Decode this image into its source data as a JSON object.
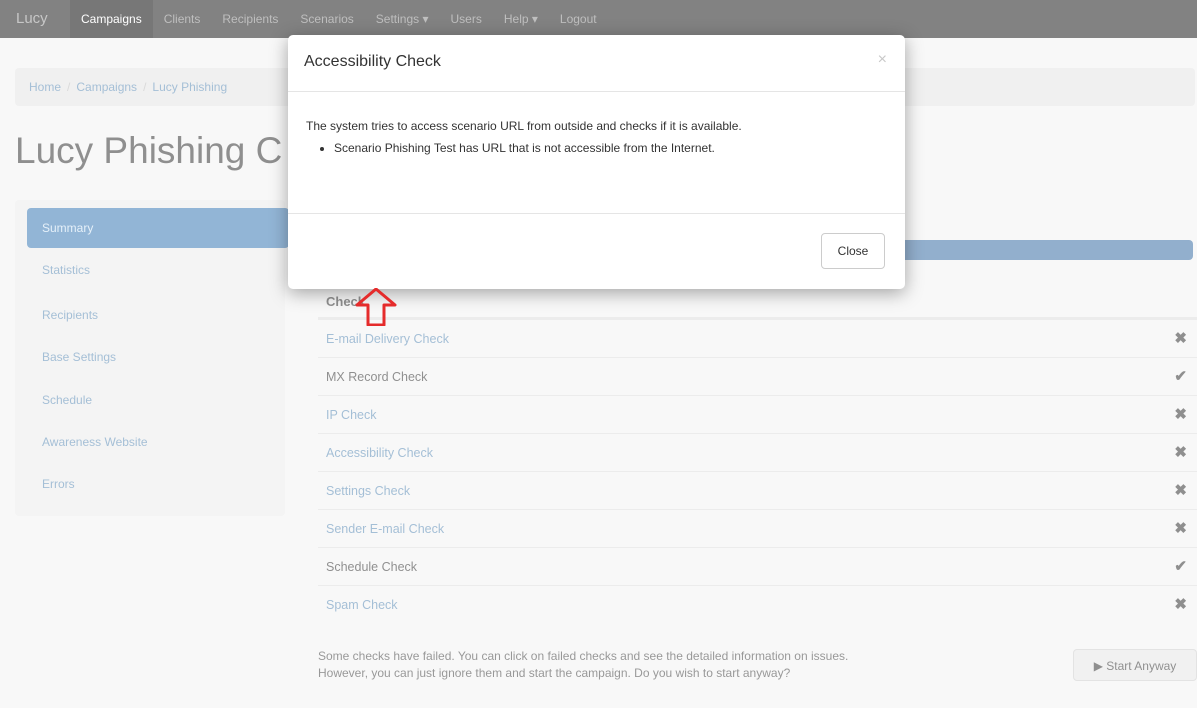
{
  "navbar": {
    "brand": "Lucy",
    "items": [
      "Campaigns",
      "Clients",
      "Recipients",
      "Scenarios",
      "Settings ▾",
      "Users",
      "Help ▾",
      "Logout"
    ]
  },
  "breadcrumb": [
    "Home",
    "Campaigns",
    "Lucy Phishing"
  ],
  "page_title": "Lucy Phishing C",
  "sidebar": {
    "items": [
      {
        "label": "Summary",
        "active": true
      },
      {
        "label": "Statistics"
      },
      {
        "label": "Recipients"
      },
      {
        "label": "Base Settings"
      },
      {
        "label": "Schedule"
      },
      {
        "label": "Awareness Website"
      },
      {
        "label": "Errors"
      }
    ]
  },
  "checks": {
    "header": "Check",
    "rows": [
      {
        "label": "E-mail Delivery Check",
        "status": "✖",
        "link": true
      },
      {
        "label": "MX Record Check",
        "status": "✔",
        "link": false
      },
      {
        "label": "IP Check",
        "status": "✖",
        "link": true
      },
      {
        "label": "Accessibility Check",
        "status": "✖",
        "link": true
      },
      {
        "label": "Settings Check",
        "status": "✖",
        "link": true
      },
      {
        "label": "Sender E-mail Check",
        "status": "✖",
        "link": true
      },
      {
        "label": "Schedule Check",
        "status": "✔",
        "link": false
      },
      {
        "label": "Spam Check",
        "status": "✖",
        "link": true
      }
    ]
  },
  "notice": "Some checks have failed. You can click on failed checks and see the detailed information on issues. However, you can just ignore them and start the campaign. Do you wish to start anyway?",
  "start_button": "▶ Start Anyway",
  "modal": {
    "title": "Accessibility Check",
    "close_x": "×",
    "message": "The system tries to access scenario URL from outside and checks if it is available.",
    "items": [
      "Scenario Phishing Test has URL that is not accessible from the Internet."
    ],
    "close_button": "Close"
  },
  "colors": {
    "navbar": "#1d1d1d",
    "link": "#5a8ab5",
    "active": "#3a78b4",
    "progress": "#3a6ea5",
    "annotation_arrow": "#e52b2b"
  }
}
